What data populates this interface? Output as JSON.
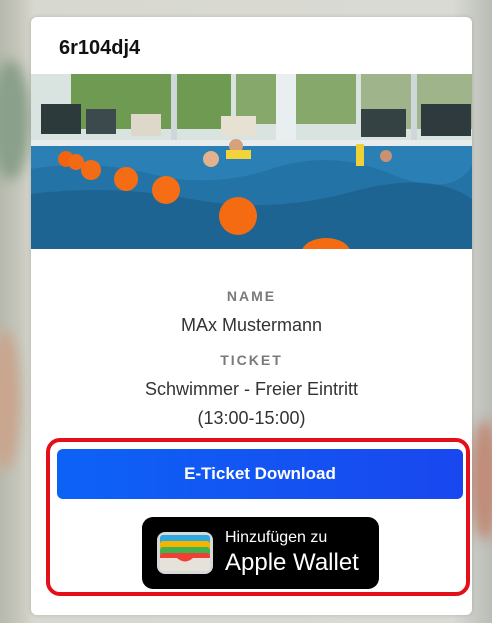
{
  "ticket": {
    "code": "6r104dj4",
    "name_label": "NAME",
    "name_value": "MAx Mustermann",
    "ticket_label": "TICKET",
    "ticket_value_line1": "Schwimmer - Freier Eintritt",
    "ticket_value_line2": "(13:00-15:00)"
  },
  "actions": {
    "download_label": "E-Ticket Download",
    "wallet_line1": "Hinzufügen zu",
    "wallet_line2": "Apple Wallet"
  },
  "colors": {
    "download_button": "#1756f2",
    "highlight_border": "#e3101b",
    "wallet_button": "#000000"
  },
  "icons": {
    "wallet": "apple-wallet-icon"
  }
}
